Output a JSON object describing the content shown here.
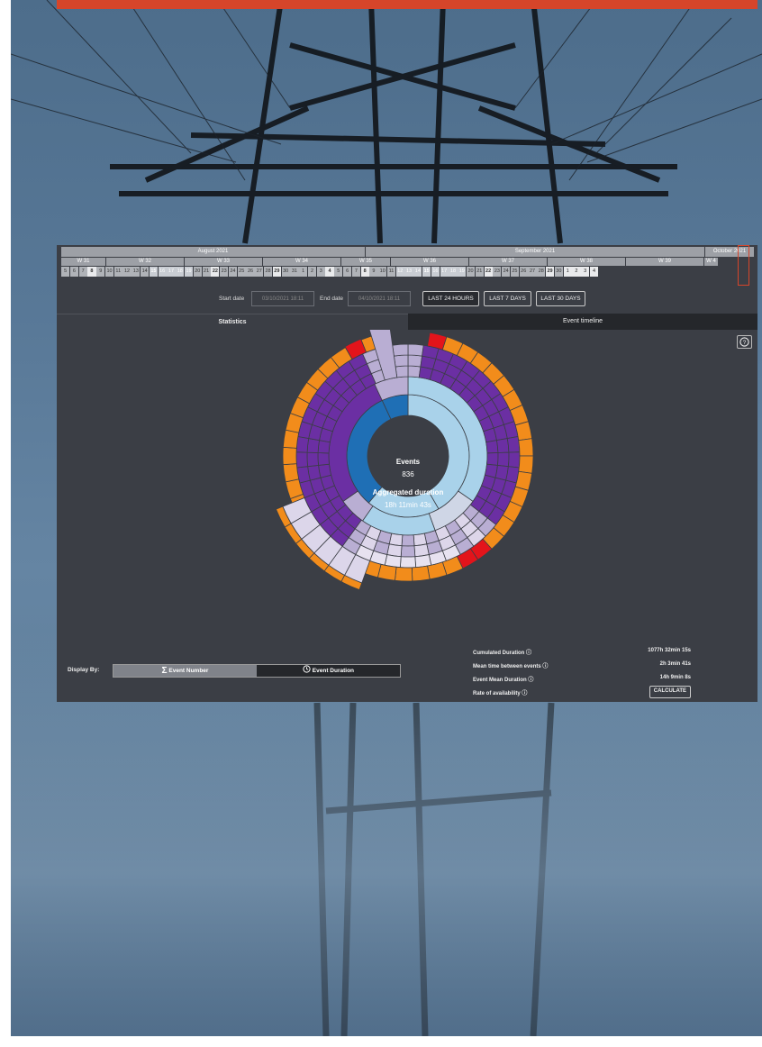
{
  "colors": {
    "accent_bar": "#d6452a",
    "panel_bg": "#3b3e45",
    "inner_blue": "#1f6fb5",
    "light_blue": "#a9d2ea",
    "purple": "#6b2fa3",
    "lavender": "#b9aed3",
    "orange": "#f28c1b",
    "red": "#e3141b",
    "yellow": "#f4c430"
  },
  "calendar": {
    "months": [
      {
        "label": "August 2021"
      },
      {
        "label": "September 2021"
      },
      {
        "label": "October 2021"
      }
    ],
    "weeks": [
      {
        "label": "W 31"
      },
      {
        "label": "W 32"
      },
      {
        "label": "W 33"
      },
      {
        "label": "W 34"
      },
      {
        "label": "W 35"
      },
      {
        "label": "W 36"
      },
      {
        "label": "W 37"
      },
      {
        "label": "W 38"
      },
      {
        "label": "W 39"
      },
      {
        "label": "W 4"
      }
    ],
    "days": [
      "5",
      "6",
      "7",
      "8",
      "9",
      "10",
      "11",
      "12",
      "13",
      "14",
      "15",
      "16",
      "17",
      "18",
      "19",
      "20",
      "21",
      "22",
      "23",
      "24",
      "25",
      "26",
      "27",
      "28",
      "29",
      "30",
      "31",
      "1",
      "2",
      "3",
      "4",
      "5",
      "6",
      "7",
      "8",
      "9",
      "10",
      "11",
      "12",
      "13",
      "14",
      "15",
      "16",
      "17",
      "18",
      "19",
      "20",
      "21",
      "22",
      "23",
      "24",
      "25",
      "26",
      "27",
      "28",
      "29",
      "30",
      "1",
      "2",
      "3",
      "4"
    ]
  },
  "date_filter": {
    "start_label": "Start date",
    "start_value": "03/10/2021 18:11",
    "end_label": "End date",
    "end_value": "04/10/2021 18:11",
    "buttons": [
      "LAST 24 HOURS",
      "LAST 7 DAYS",
      "LAST 30 DAYS"
    ]
  },
  "tabs": {
    "statistics": "Statistics",
    "timeline": "Event timeline"
  },
  "help_icon": "question-circle-icon",
  "sunburst": {
    "center_title": "Events",
    "center_count": "836",
    "center_subtitle": "Aggregated duration",
    "center_duration": "18h 11min 43s"
  },
  "display_by": {
    "label": "Display By:",
    "option_number": "Event Number",
    "option_duration": "Event Duration",
    "number_icon": "sigma-icon",
    "duration_icon": "clock-icon"
  },
  "stats": {
    "cumulated_label": "Cumulated Duration ⓘ",
    "cumulated_value": "1077h 32min 15s",
    "mtbe_label": "Mean time between events ⓘ",
    "mtbe_value": "2h 3min 41s",
    "mean_duration_label": "Event Mean Duration ⓘ",
    "mean_duration_value": "14h 9min 8s",
    "availability_label": "Rate of availability ⓘ",
    "calculate_button": "CALCULATE"
  }
}
